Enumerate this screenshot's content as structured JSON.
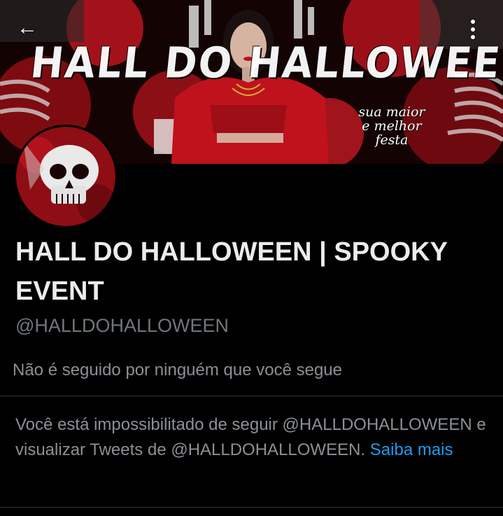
{
  "header": {
    "back_icon": "arrow-left-icon",
    "more_icon": "more-vertical-icon"
  },
  "banner": {
    "title_art": "HALL DO HALLOWEEN",
    "tagline": [
      "sua maior",
      "e melhor",
      "festa"
    ],
    "accent_color": "#b3121b"
  },
  "profile": {
    "name": "HALL DO HALLOWEEN | SPOOKY EVENT",
    "handle": "@HALLDOHALLOWEEN",
    "followers_note": "Não é seguido por ninguém que você segue"
  },
  "notice": {
    "message": "Você está impossibilitado de seguir @HALLDOHALLOWEEN e visualizar Tweets de @HALLDOHALLOWEEN.",
    "link_label": "Saiba mais",
    "link_color": "#1d9bf0"
  }
}
